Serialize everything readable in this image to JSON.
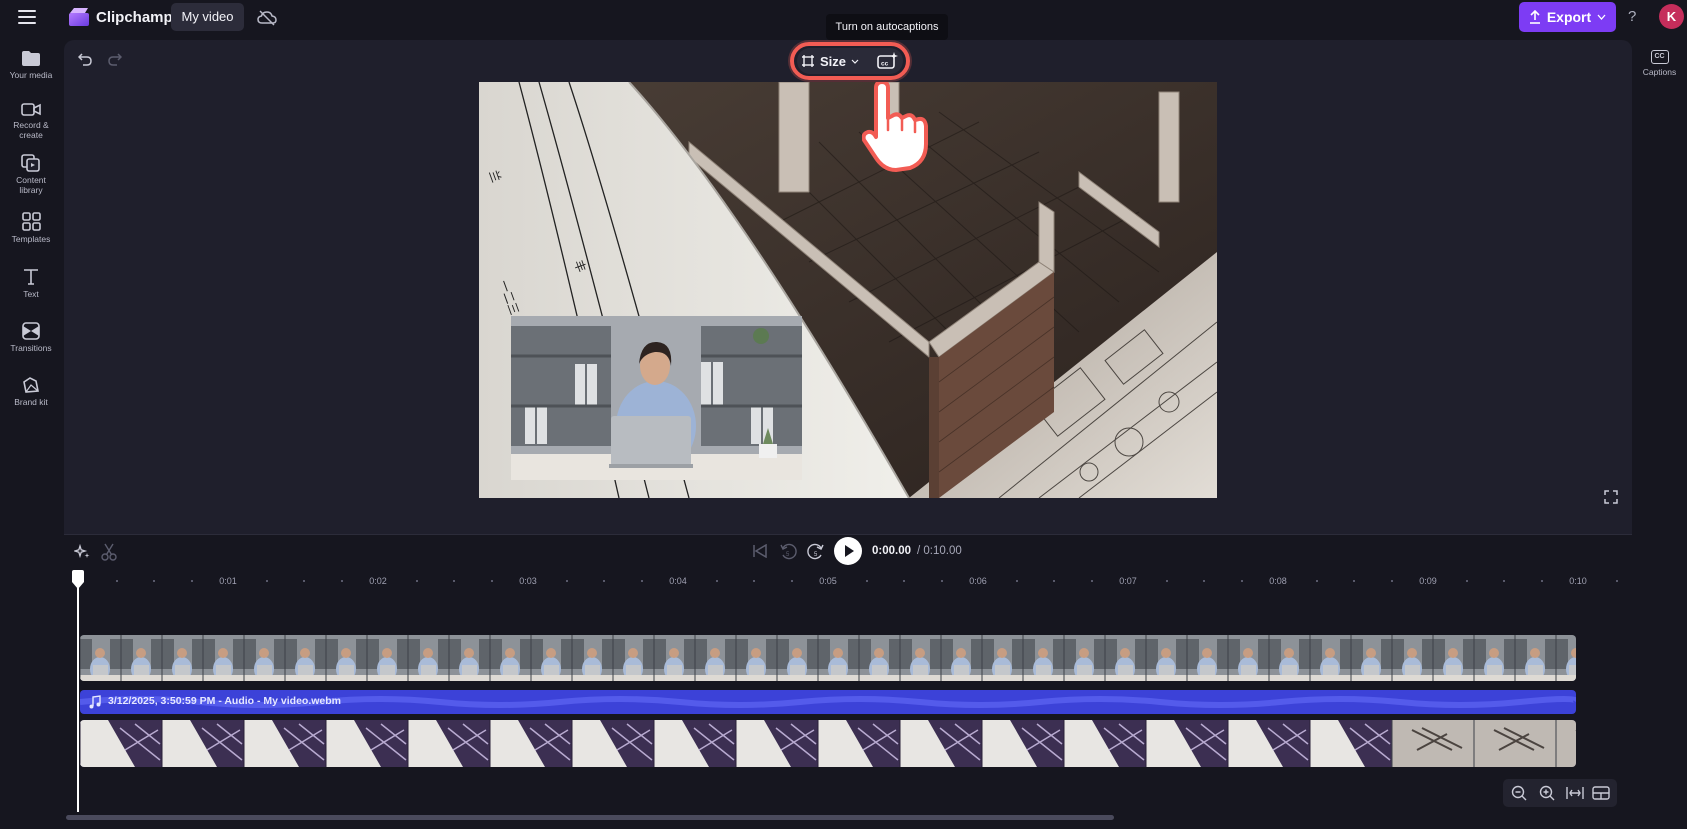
{
  "header": {
    "app_name": "Clipchamp",
    "project_title": "My video",
    "export_label": "Export",
    "help_label": "?",
    "avatar_initial": "K"
  },
  "sidebar": {
    "items": [
      {
        "label": "Your media",
        "icon": "folder-icon"
      },
      {
        "label": "Record &\ncreate",
        "icon": "camera-icon"
      },
      {
        "label": "Content\nlibrary",
        "icon": "library-icon"
      },
      {
        "label": "Templates",
        "icon": "templates-icon"
      },
      {
        "label": "Text",
        "icon": "text-icon"
      },
      {
        "label": "Transitions",
        "icon": "transitions-icon"
      },
      {
        "label": "Brand kit",
        "icon": "brand-kit-icon"
      }
    ]
  },
  "right_panel": {
    "captions_label": "Captions",
    "captions_icon_text": "CC"
  },
  "stage": {
    "tooltip": "Turn on autocaptions",
    "size_label": "Size"
  },
  "timeline": {
    "time_current": "0:00.00",
    "time_total": "/ 0:10.00",
    "ticks": [
      "0:01",
      "0:02",
      "0:03",
      "0:04",
      "0:05",
      "0:06",
      "0:07",
      "0:08",
      "0:09",
      "0:10"
    ],
    "audio_track_label": "3/12/2025, 3:50:59 PM - Audio - My video.webm"
  },
  "colors": {
    "accent": "#7d3cf4",
    "highlight": "#f25c54",
    "audio_track": "#3c42d8"
  }
}
